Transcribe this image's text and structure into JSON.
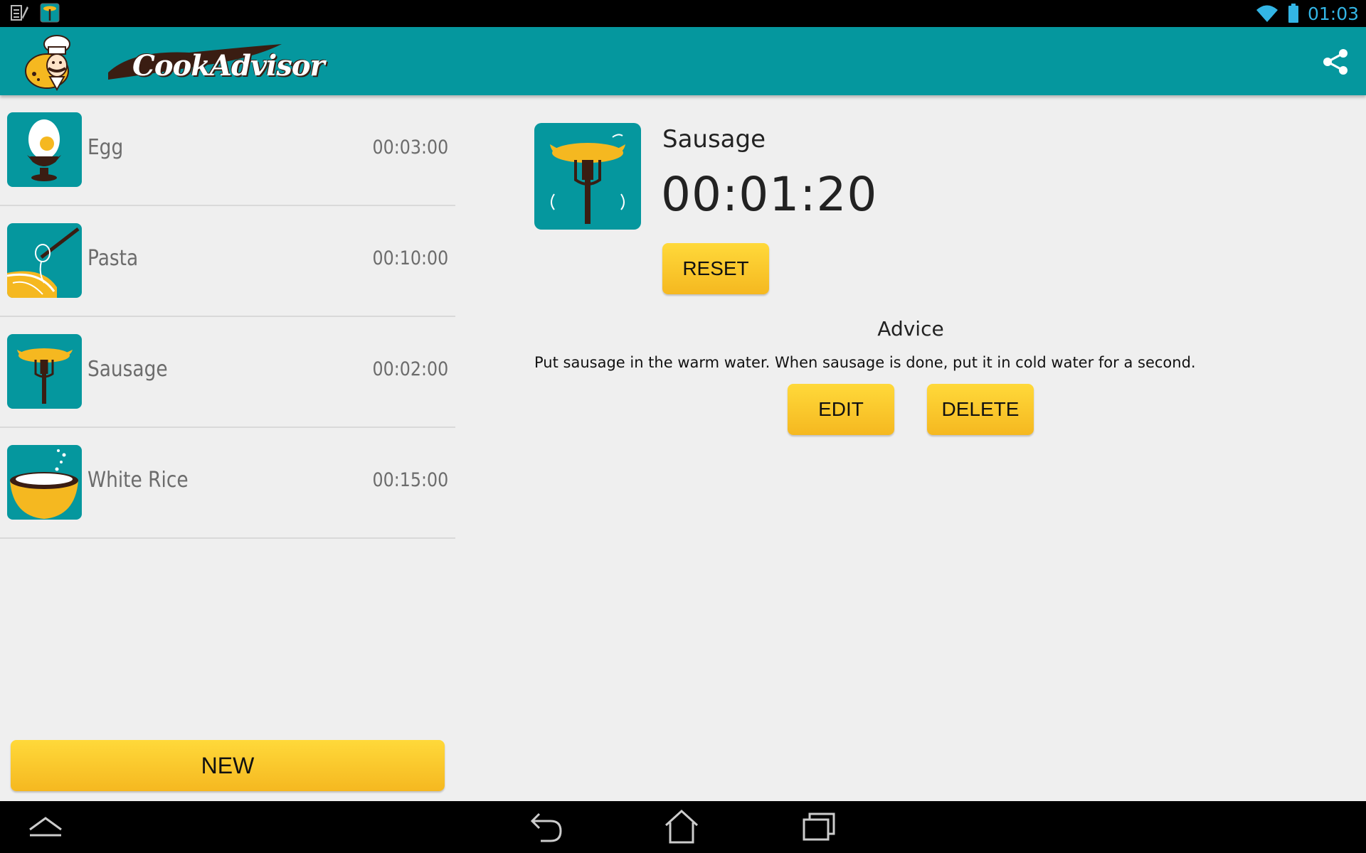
{
  "status_bar": {
    "time": "01:03",
    "icons": [
      "notification-clipboard-icon",
      "notification-app-icon",
      "wifi-icon",
      "battery-icon"
    ]
  },
  "app_bar": {
    "logo_text": "CookAdvisor",
    "actions": [
      "share-icon"
    ],
    "colors": {
      "primary": "#05979e"
    }
  },
  "recipes": [
    {
      "name": "Egg",
      "time": "00:03:00",
      "icon": "egg-icon"
    },
    {
      "name": "Pasta",
      "time": "00:10:00",
      "icon": "pasta-icon"
    },
    {
      "name": "Sausage",
      "time": "00:02:00",
      "icon": "sausage-icon"
    },
    {
      "name": "White Rice",
      "time": "00:15:00",
      "icon": "rice-icon"
    }
  ],
  "new_label": "NEW",
  "detail": {
    "title": "Sausage",
    "timer": "00:01:20",
    "reset_label": "RESET",
    "advice_heading": "Advice",
    "advice_text": "Put sausage in the warm water. When sausage is done, put it in cold water for a second.",
    "edit_label": "EDIT",
    "delete_label": "DELETE"
  },
  "nav_bar": {
    "buttons": [
      "up-icon",
      "back-icon",
      "home-icon",
      "recent-apps-icon"
    ]
  },
  "colors": {
    "button_yellow": "#f5b820",
    "background": "#efefef"
  }
}
